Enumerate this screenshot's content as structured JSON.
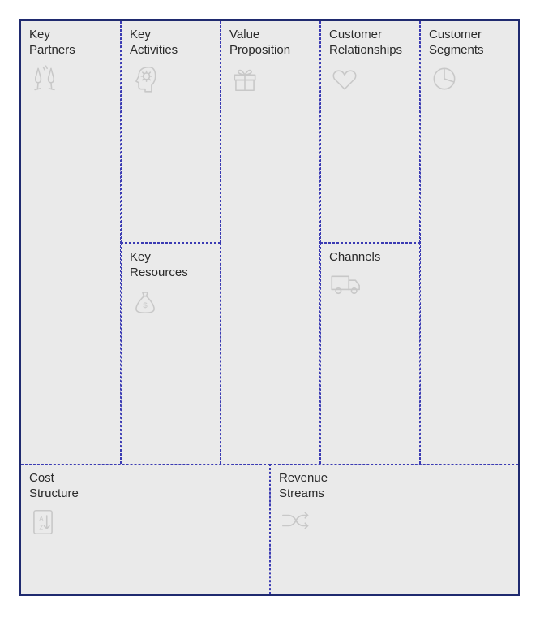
{
  "canvas": {
    "top_row": [
      {
        "key": "partners",
        "label": "Key\nPartners",
        "icon": "toast-icon"
      },
      {
        "key": "activities",
        "label": "Key\nActivities",
        "icon": "head-gear-icon"
      },
      {
        "key": "value",
        "label": "Value\nProposition",
        "icon": "gift-icon"
      },
      {
        "key": "relationships",
        "label": "Customer\nRelationships",
        "icon": "heart-icon"
      },
      {
        "key": "segments",
        "label": "Customer\nSegments",
        "icon": "pie-icon"
      }
    ],
    "mid_row": [
      {
        "key": "resources",
        "label": "Key\nResources",
        "icon": "money-bag-icon"
      },
      {
        "key": "channels",
        "label": "Channels",
        "icon": "truck-icon"
      }
    ],
    "bottom_row": [
      {
        "key": "costs",
        "label": "Cost\nStructure",
        "icon": "document-sort-icon"
      },
      {
        "key": "revenue",
        "label": "Revenue\nStreams",
        "icon": "shuffle-icon"
      }
    ]
  }
}
